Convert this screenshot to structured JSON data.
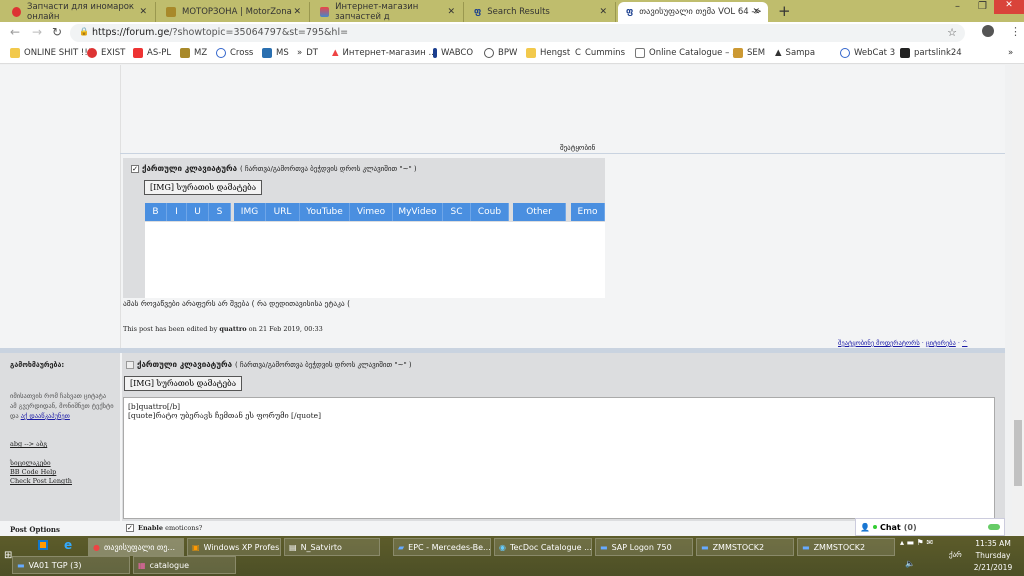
{
  "browser": {
    "tabs": [
      {
        "title": "Запчасти для иномарок онлайн"
      },
      {
        "title": "МОТОРЗОНА | MotorZona"
      },
      {
        "title": "Интернет-магазин запчастей д"
      },
      {
        "title": "Search Results"
      },
      {
        "title": "თავისუფალი თემა VOL 64 ->",
        "active": true
      }
    ],
    "url_host": "https://forum.ge",
    "url_rest": "/?showtopic=35064797&st=795&hl=",
    "bookmarks": [
      "ONLINE SHIT !!!",
      "EXIST",
      "AS-PL",
      "MZ",
      "Cross",
      "MS",
      "DT",
      "Интернет-магазин ...",
      "WABCO",
      "BPW",
      "Hengst",
      "Cummins",
      "Online Catalogue – ...",
      "SEM",
      "Sampa",
      "WebCat 3",
      "partslink24"
    ]
  },
  "post": {
    "report_cut": "შეატყობინ",
    "keyboard_label": "ქართული კლავიატურა",
    "keyboard_hint": "( ჩართვა/გამორთვა ბეჭდვის დროს კლავიშით \"~\" )",
    "img_button": "[IMG] სურათის დამატება",
    "toolbar": [
      "B",
      "I",
      "U",
      "S",
      "IMG",
      "URL",
      "YouTube",
      "Vimeo",
      "MyVideo",
      "SC",
      "Coub",
      "Other",
      "Emo"
    ],
    "body": "ამას როვაწვები არაფერს არ შვება ( რა დედითავისისა ეტაკა (",
    "edited_prefix": "This post has been edited by ",
    "edited_user": "quattro",
    "edited_suffix": " on 21 Feb 2019, 00:33",
    "links": {
      "report": "შეატყობინე მოდერატორს",
      "sep": "·",
      "quote": "ციტირება",
      "top": "^"
    }
  },
  "reply": {
    "title": "გამოხმაურება:",
    "hint_text": "იმისათვის რომ ჩასვათ ციტატა ამ გვერდიდან, მონიშნეთ ტექსტი და ",
    "hint_link": "აქ დააწკაპუნეთ",
    "translit": "abg --> აბგ",
    "smilies": "სიცილაკები",
    "bbcode": "BB Code Help",
    "check": "Check Post Length",
    "keyboard_label": "ქართული კლავიატურა",
    "keyboard_hint": "( ჩართვა/გამორთვა ბეჭდვის დროს კლავიშით \"~\" )",
    "img_button": "[IMG] სურათის დამატება",
    "text_line1": "[b]quattro[/b]",
    "text_line2": "[quote]რატო უბერავს ჩემთან ეს ფორუმი  [/quote]",
    "post_options": "Post Options",
    "enable_bold": "Enable",
    "enable_rest": " emoticons?"
  },
  "chat": {
    "label": "Chat",
    "count": "(0)"
  },
  "taskbar": {
    "row1": [
      "თავისუფალი თე...",
      "Windows XP Profes...",
      "N_Satvirto",
      "EPC - Mercedes-Be...",
      "TecDoc Catalogue ...",
      "SAP Logon 750",
      "ZMMSTOCK2",
      "ZMMSTOCK2"
    ],
    "row2": [
      "VA01 TGP (3)",
      "catalogue"
    ],
    "lang": "ქარ",
    "time": "11:35 AM",
    "day": "Thursday",
    "date": "2/21/2019"
  },
  "colors": {
    "tabbar": "#bfbd6d",
    "toolbar_button": "#4a8fe0",
    "link": "#1a1aa6"
  }
}
